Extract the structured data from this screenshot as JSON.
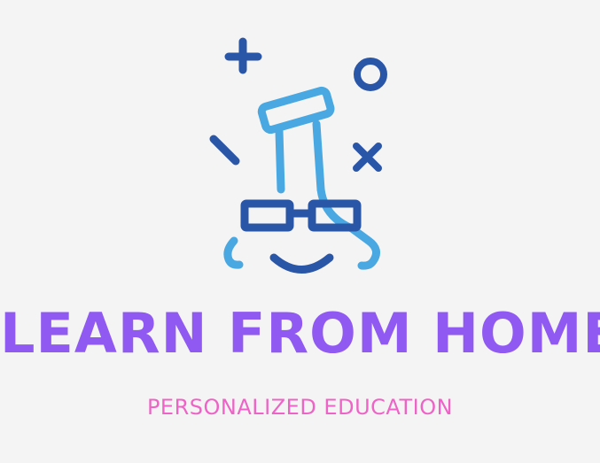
{
  "brand": {
    "name": "LEARN FROM HOME",
    "tagline": "PERSONALIZED EDUCATION"
  },
  "colors": {
    "background": "#f5f4f4",
    "brand_name": "#8f59f2",
    "tagline": "#ee64c6",
    "icon_light_blue": "#49a8e2",
    "icon_dark_blue": "#2a56a8"
  },
  "icons": [
    "plus-icon",
    "circle-icon",
    "dash-icon",
    "cross-icon",
    "flask-icon",
    "glasses-icon",
    "smile-icon"
  ]
}
